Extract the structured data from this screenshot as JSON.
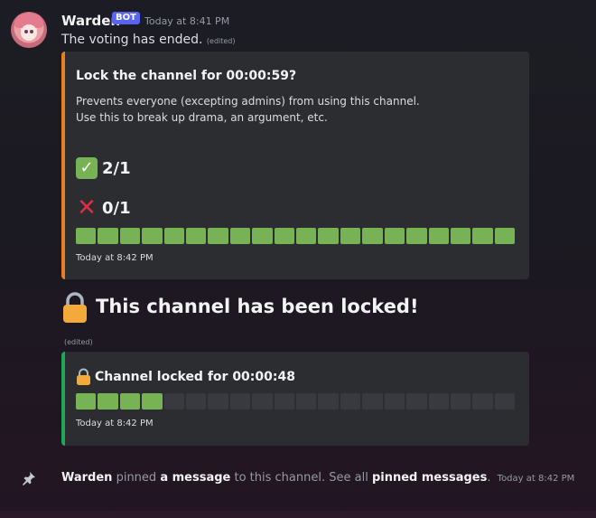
{
  "message": {
    "username": "Warden",
    "bot_tag": "BOT",
    "timestamp": "Today at 8:41 PM",
    "text": "The voting has ended.",
    "edited": "(edited)"
  },
  "vote_embed": {
    "accent_color": "#e67e22",
    "title": "Lock the channel for 00:00:59?",
    "description_line1": "Prevents everyone (excepting admins) from using this channel.",
    "description_line2": "Use this to break up drama, an argument, etc.",
    "yes_icon": "check-mark-icon",
    "yes_count": "2/1",
    "no_icon": "cross-mark-icon",
    "no_count": "0/1",
    "progress_fraction": 1.0,
    "footer": "Today at 8:42 PM"
  },
  "locked_message": {
    "icon": "lock-icon",
    "text": "This channel has been locked!",
    "edited": "(edited)"
  },
  "lock_embed": {
    "accent_color": "#23a559",
    "icon": "lock-icon",
    "title": "Channel locked for 00:00:48",
    "progress_fraction": 0.2,
    "footer": "Today at 8:42 PM"
  },
  "pin_notice": {
    "icon": "pin-icon",
    "user": "Warden",
    "text_pinned": "pinned",
    "link_message": "a message",
    "text_middle": "to this channel. See all",
    "link_pinned": "pinned messages",
    "text_end": ".",
    "timestamp": "Today at 8:42 PM"
  },
  "colors": {
    "bot_tag": "#5865f2",
    "progress_on": "#77b255",
    "progress_off": "#383a40",
    "lock_body": "#f4a93b"
  }
}
